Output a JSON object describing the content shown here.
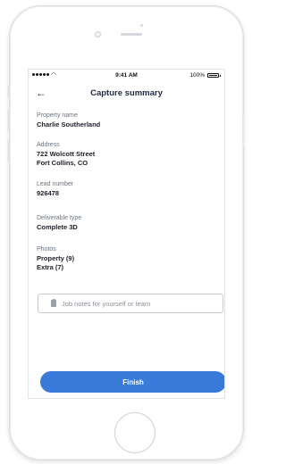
{
  "status_bar": {
    "time": "9:41 AM",
    "battery": "100%",
    "signal_icon": "signal-dots-icon",
    "wifi_icon": "wifi-icon"
  },
  "nav": {
    "title": "Capture summary",
    "back_icon": "←"
  },
  "summary": {
    "property_name": {
      "label": "Property name",
      "value": "Charlie Southerland"
    },
    "address": {
      "label": "Address",
      "line1": "722 Wolcott Street",
      "line2": "Fort Collins, CO"
    },
    "lead_number": {
      "label": "Lead number",
      "value": "926478"
    },
    "deliverable_type": {
      "label": "Deliverable type",
      "value": "Complete 3D"
    },
    "photos": {
      "label": "Photos",
      "item1": "Property (9)",
      "item2": "Extra (7)"
    }
  },
  "notes": {
    "placeholder": "Job notes for yourself or team",
    "icon": "clipboard-icon"
  },
  "finish_button": {
    "label": "Finish"
  },
  "colors": {
    "accent": "#3a7ad9",
    "title": "#1f2a44"
  }
}
